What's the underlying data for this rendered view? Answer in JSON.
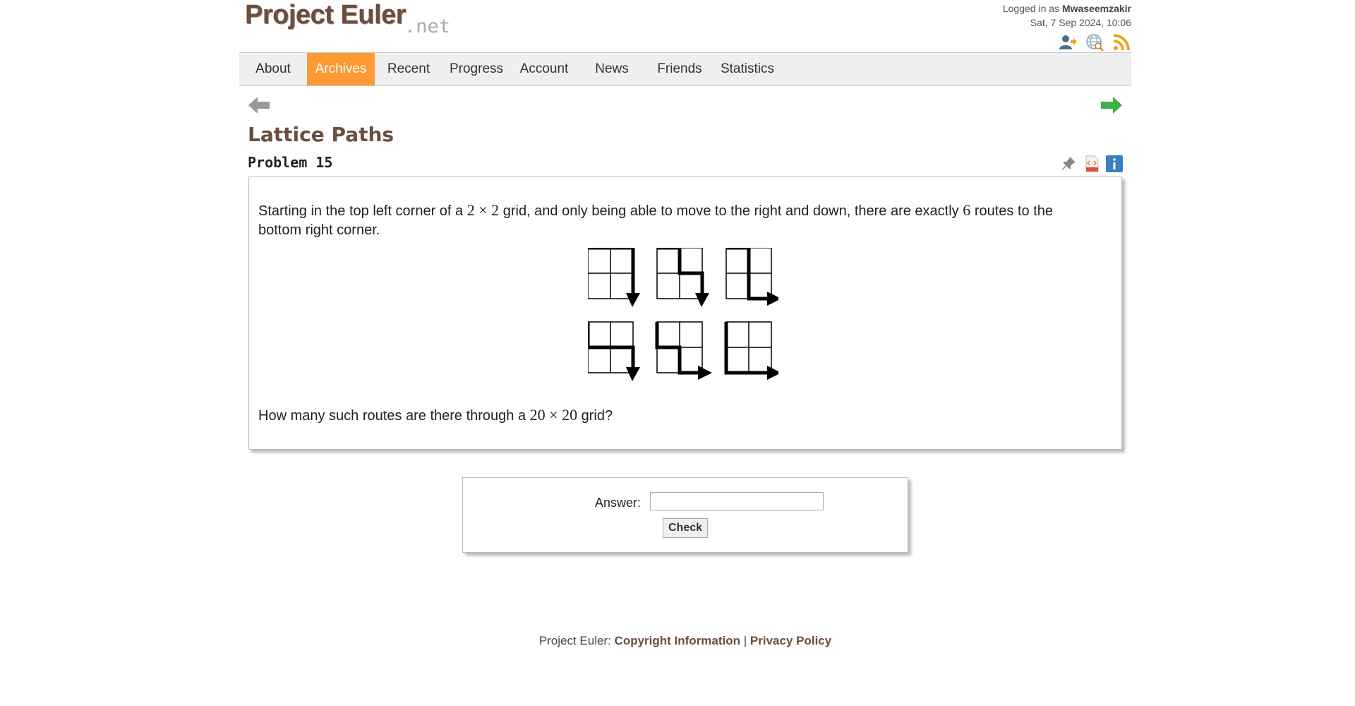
{
  "header": {
    "logo_main": "Project Euler",
    "logo_suffix": ".net",
    "logged_in_prefix": "Logged in as",
    "username": "Mwaseemzakir",
    "datetime": "Sat, 7 Sep 2024, 10:06",
    "icons": [
      "add-friend-icon",
      "globe-icon",
      "rss-icon"
    ]
  },
  "nav": {
    "items": [
      {
        "label": "About"
      },
      {
        "label": "Archives",
        "active": true
      },
      {
        "label": "Recent"
      },
      {
        "label": "Progress"
      },
      {
        "label": "Account"
      },
      {
        "label": "News"
      },
      {
        "label": "Friends"
      },
      {
        "label": "Statistics"
      }
    ],
    "active_color": "#ff9933"
  },
  "problem": {
    "title": "Lattice Paths",
    "number_label": "Problem 15",
    "icons": [
      "pin-icon",
      "html-file-icon",
      "info-icon"
    ],
    "text1_prefix": "Starting in the top left corner of a",
    "text1_math": "2 × 2",
    "text1_mid": "grid, and only being able to move to the right and down, there are exactly",
    "text1_num": "6",
    "text1_suffix": "routes to the",
    "text1_line2": "bottom right corner.",
    "text2_prefix": "How many such routes are there through a",
    "text2_math": "20 × 20",
    "text2_suffix": "grid?"
  },
  "answer": {
    "label": "Answer:",
    "value": "",
    "check_label": "Check"
  },
  "footer": {
    "prefix": "Project Euler:",
    "copyright_link": "Copyright Information",
    "separator": "|",
    "privacy_link": "Privacy Policy"
  },
  "colors": {
    "brand_brown": "#6b4e3d",
    "next_arrow": "#3cb043",
    "prev_arrow": "#999999"
  }
}
